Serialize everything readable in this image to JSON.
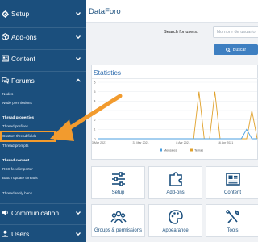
{
  "sidebar": {
    "sections": [
      {
        "label": "Setup",
        "icon": "gear-icon"
      },
      {
        "label": "Add-ons",
        "icon": "cube-icon"
      },
      {
        "label": "Content",
        "icon": "content-icon"
      },
      {
        "label": "Forums",
        "icon": "comments-icon"
      },
      {
        "label": "Communication",
        "icon": "broadcast-icon"
      },
      {
        "label": "Users",
        "icon": "user-icon"
      }
    ],
    "forums_items": {
      "nodes": "Nodes",
      "node_permissions": "Node permissions",
      "thread_properties_header": "Thread properties",
      "thread_prefixes": "Thread prefixes",
      "custom_thread_fields": "Custom thread fields",
      "thread_prompts": "Thread prompts",
      "thread_content_header": "Thread content",
      "rss_feed_importer": "RSS feed importer",
      "batch_update_threads": "Batch update threads",
      "thread_reply_bans": "Thread reply bans"
    }
  },
  "header": {
    "board_title": "DataForo"
  },
  "search": {
    "label": "Search for users:",
    "placeholder": "Nombre de usuario",
    "button_label": "Buscar"
  },
  "statistics": {
    "title": "Statistics"
  },
  "chart_data": {
    "type": "line",
    "x": [
      "23 Mar 2021",
      "31 Mar 2021",
      "8 Apr 2021",
      "16 Apr 2021"
    ],
    "ylim": [
      0,
      6
    ],
    "yticks": [
      "0",
      "1",
      "2",
      "3",
      "4",
      "5",
      "6"
    ],
    "series": [
      {
        "name": "Mensajes",
        "color": "#4a9fe0",
        "values": [
          0,
          0,
          0,
          0,
          0,
          0,
          0,
          0,
          0,
          0,
          0,
          0,
          0,
          0,
          0,
          0,
          0,
          0,
          0,
          0,
          0,
          0,
          0,
          0,
          0,
          0,
          0,
          0,
          1,
          0,
          0
        ]
      },
      {
        "name": "Temas",
        "color": "#e0a12b",
        "values": [
          0,
          0,
          0,
          0,
          0,
          0,
          0,
          0,
          0,
          0,
          0,
          0,
          0,
          0,
          0,
          0,
          0,
          0,
          0,
          5,
          0,
          0,
          5,
          0,
          0,
          0,
          0,
          0,
          0,
          3,
          0
        ]
      }
    ],
    "grid": true,
    "legend": "bottom"
  },
  "tiles": [
    {
      "label": "Setup",
      "icon": "sliders-icon"
    },
    {
      "label": "Add-ons",
      "icon": "puzzle-icon"
    },
    {
      "label": "Content",
      "icon": "content-icon"
    },
    {
      "label": "Groups & permissions",
      "icon": "groups-icon"
    },
    {
      "label": "Appearance",
      "icon": "palette-icon"
    },
    {
      "label": "Tools",
      "icon": "tools-icon"
    }
  ],
  "colors": {
    "sidebar": "#1b4f7d",
    "accent": "#3e7fc1",
    "highlight": "#f29b2e"
  }
}
